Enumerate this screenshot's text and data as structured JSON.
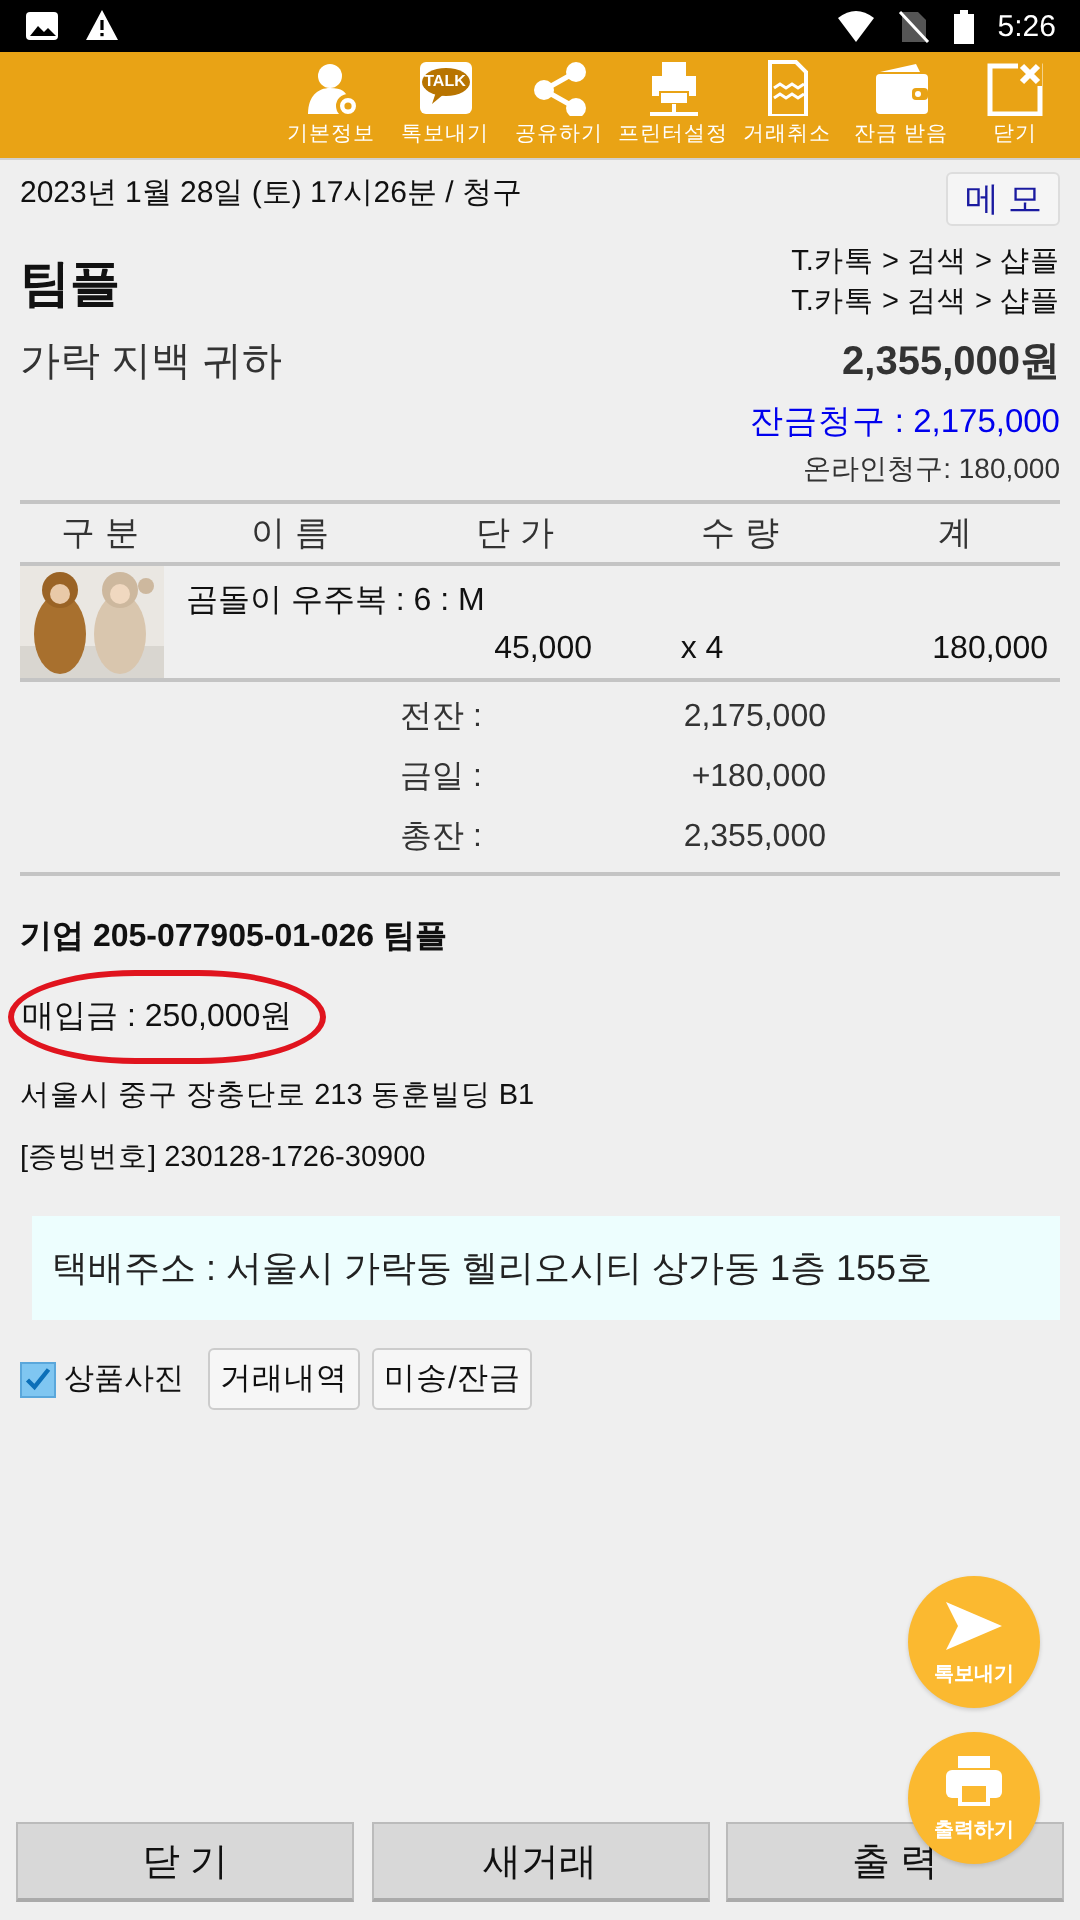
{
  "status_bar": {
    "time": "5:26"
  },
  "toolbar": [
    {
      "kind": "profile",
      "label": "기본정보"
    },
    {
      "kind": "talk",
      "label": "톡보내기",
      "icon_text": "TALK"
    },
    {
      "kind": "share",
      "label": "공유하기"
    },
    {
      "kind": "printer",
      "label": "프린터설정"
    },
    {
      "kind": "receipt",
      "label": "거래취소"
    },
    {
      "kind": "wallet",
      "label": "잔금 받음"
    },
    {
      "kind": "close",
      "label": "닫기"
    }
  ],
  "header": {
    "datetime": "2023년 1월 28일 (토) 17시26분 / 청구",
    "memo_button": "메 모"
  },
  "shop": {
    "name": "팀플",
    "paths": [
      "T.카톡 > 검색 > 샵플",
      "T.카톡 > 검색 > 샵플"
    ]
  },
  "customer": {
    "name": "가락 지백 귀하",
    "total": "2,355,000원",
    "balance_request": "잔금청구 : 2,175,000",
    "online_request": "온라인청구: 180,000"
  },
  "table": {
    "columns": [
      "구 분",
      "이 름",
      "단 가",
      "수 량",
      "계"
    ],
    "rows": [
      {
        "kind": "picture",
        "name": "곰돌이 우주복 : 6 : M",
        "price": "45,000",
        "qty": "x 4",
        "amount": "180,000"
      }
    ]
  },
  "summary": [
    {
      "label": "전잔 :",
      "value": "2,175,000"
    },
    {
      "label": "금일 :",
      "value": "+180,000"
    },
    {
      "label": "총잔 :",
      "value": "2,355,000"
    }
  ],
  "info": [
    {
      "kind": "account",
      "text": "기업 205-077905-01-026 팀플",
      "highlighted": false
    },
    {
      "kind": "purchase",
      "text": "매입금 : 250,000원",
      "highlighted": true
    },
    {
      "kind": "address",
      "text": "서울시 중구 장충단로 213 동훈빌딩 B1",
      "highlighted": false
    },
    {
      "kind": "receipt",
      "text": "[증빙번호] 230128-1726-30900",
      "highlighted": false
    }
  ],
  "delivery": "택배주소 : 서울시 가락동 헬리오시티 상가동 1층 155호",
  "options": {
    "photo_checkbox": {
      "label": "상품사진",
      "checked": true
    },
    "buttons": [
      "거래내역",
      "미송/잔금"
    ]
  },
  "fabs": [
    {
      "kind": "send",
      "label": "톡보내기"
    },
    {
      "kind": "print",
      "label": "출력하기"
    }
  ],
  "bottom_buttons": [
    "닫 기",
    "새거래",
    "출 력"
  ]
}
